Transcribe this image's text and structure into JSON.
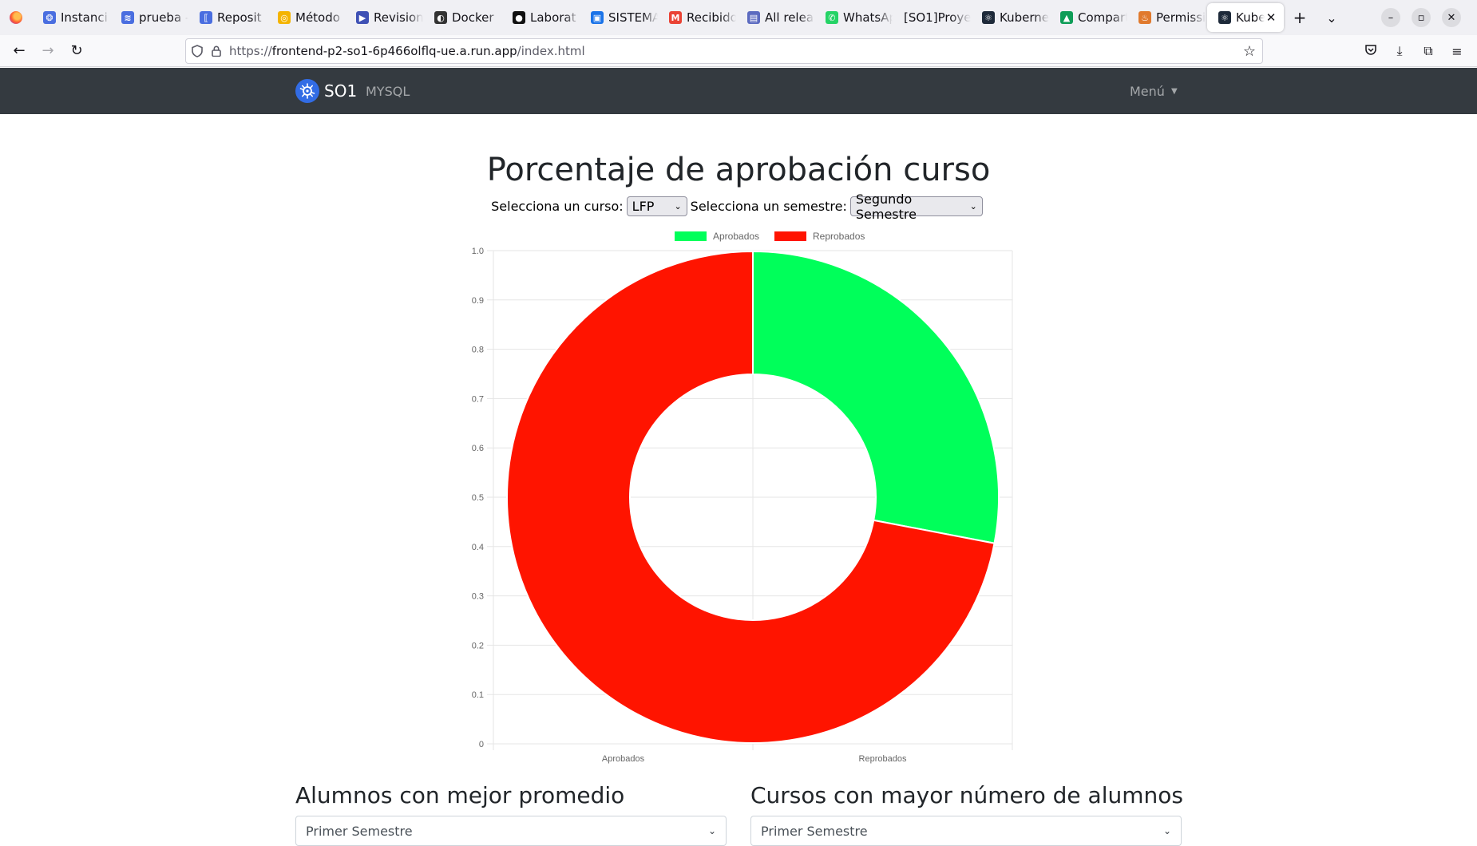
{
  "browser": {
    "tabs": [
      {
        "label": "Instanci",
        "fav_color": "#4a6ee0",
        "fav_char": "❂"
      },
      {
        "label": "prueba –",
        "fav_color": "#4a6ee0",
        "fav_char": "≋"
      },
      {
        "label": "Reposit",
        "fav_color": "#4a6ee0",
        "fav_char": "⟦"
      },
      {
        "label": "Método",
        "fav_color": "#f4b400",
        "fav_char": "◎"
      },
      {
        "label": "Revision",
        "fav_color": "#3f51b5",
        "fav_char": "▶"
      },
      {
        "label": "Docker",
        "fav_color": "#333333",
        "fav_char": "◐"
      },
      {
        "label": "Laborat",
        "fav_color": "#111111",
        "fav_char": "●"
      },
      {
        "label": "SISTEMA",
        "fav_color": "#1a73e8",
        "fav_char": "▣"
      },
      {
        "label": "Recibido",
        "fav_color": "#ea4335",
        "fav_char": "M"
      },
      {
        "label": "All relea",
        "fav_color": "#5c6bc0",
        "fav_char": "▤"
      },
      {
        "label": "WhatsAp",
        "fav_color": "#25d366",
        "fav_char": "✆"
      },
      {
        "label": "[SO1]Proye",
        "fav_color": "",
        "fav_char": ""
      },
      {
        "label": "Kuberne",
        "fav_color": "#1e2a3a",
        "fav_char": "⚛"
      },
      {
        "label": "Compart",
        "fav_color": "#0f9d58",
        "fav_char": "▲"
      },
      {
        "label": "Permissi",
        "fav_color": "#e07a2e",
        "fav_char": "♨"
      }
    ],
    "active_tab": {
      "label": "Kuber",
      "fav_color": "#1e2a3a",
      "fav_char": "⚛"
    },
    "new_tab_label": "+",
    "list_tabs_label": "⌄",
    "url_prefix": "https://",
    "url_host": "frontend-p2-so1-6p466olflq-ue.a.run.app",
    "url_path": "/index.html",
    "icons": [
      "back-icon",
      "forward-icon",
      "reload-icon",
      "shield-icon",
      "lock-icon",
      "star-icon",
      "pocket-icon",
      "download-icon",
      "extensions-icon",
      "menu-icon"
    ]
  },
  "site_nav": {
    "brand": "SO1",
    "link": "MYSQL",
    "menu": "Menú"
  },
  "main": {
    "title": "Porcentaje de aprobación curso",
    "course_label": "Selecciona un curso:",
    "course_value": "LFP",
    "semester_label": "Selecciona un semestre:",
    "semester_value": "Segundo Semestre"
  },
  "chart_data": {
    "type": "pie",
    "subtype": "doughnut",
    "categories": [
      "Aprobados",
      "Reprobados"
    ],
    "series": [
      {
        "name": "Aprobados",
        "color": "#00ff5a"
      },
      {
        "name": "Reprobados",
        "color": "#ff1400"
      }
    ],
    "values": [
      0.28,
      0.72
    ],
    "legend_position": "top",
    "ylim": [
      0,
      1.0
    ],
    "yticks": [
      "1.0",
      "0.9",
      "0.8",
      "0.7",
      "0.6",
      "0.5",
      "0.4",
      "0.3",
      "0.2",
      "0.1",
      "0"
    ],
    "xticks": [
      "Aprobados",
      "Reprobados"
    ],
    "grid": true
  },
  "sections": {
    "left_title": "Alumnos con mejor promedio",
    "left_select": "Primer Semestre",
    "right_title": "Cursos con mayor número de alumnos",
    "right_select": "Primer Semestre"
  }
}
